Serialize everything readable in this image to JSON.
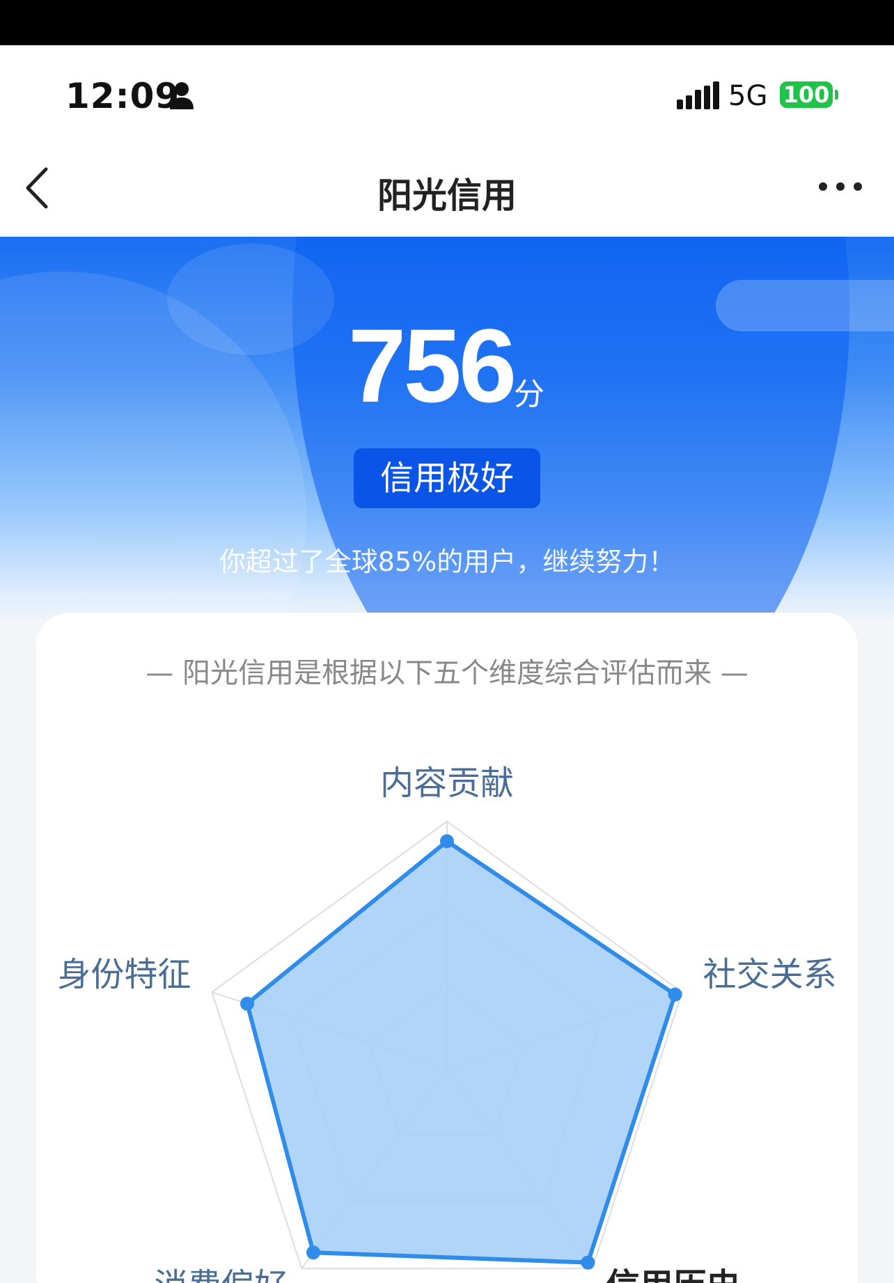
{
  "status_bar": {
    "time": "12:09",
    "network": "5G",
    "battery": "100"
  },
  "navbar": {
    "title": "阳光信用"
  },
  "hero": {
    "score": "756",
    "score_unit": "分",
    "level": "信用极好",
    "percent_note": "你超过了全球85%的用户，继续努力！"
  },
  "card": {
    "subtitle": "— 阳光信用是根据以下五个维度综合评估而来 —",
    "radar": {
      "axes": [
        {
          "label": "内容贡献",
          "value": 0.92
        },
        {
          "label": "社交关系",
          "value": 0.97
        },
        {
          "label": "信用历史",
          "value": 0.97
        },
        {
          "label": "消费偏好",
          "value": 0.92
        },
        {
          "label": "身份特征",
          "value": 0.85
        }
      ]
    }
  },
  "colors": {
    "primary_blue": "#1b6ff2",
    "badge_blue": "#0a55e8",
    "radar_line": "#2f8ce8",
    "radar_fill": "#a9cff8",
    "battery_green": "#1fc34a"
  }
}
